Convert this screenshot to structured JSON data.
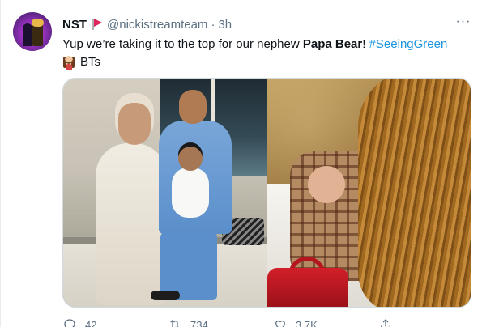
{
  "tweet": {
    "display_name": "NST",
    "handle": "@nickistreamteam",
    "separator": "·",
    "time": "3h",
    "text_line1_prefix": "Yup we’re taking it to the top for our nephew ",
    "text_line1_bold": "Papa Bear",
    "text_line1_after_bold": "! ",
    "text_line1_hashtag": "#SeeingGreen",
    "text_line2": "BTs",
    "more_label": "···",
    "icons": {
      "flag": "red-flag-icon",
      "emoji": "woman-emoji-icon",
      "reply": "reply-icon",
      "retweet": "retweet-icon",
      "like": "like-icon",
      "share": "share-icon"
    },
    "accent_color": "#1b95e0",
    "flag_color": "#e0245e"
  },
  "actions": {
    "reply_count": "42",
    "retweet_count": "734",
    "like_count": "3.7K",
    "share_count": ""
  }
}
